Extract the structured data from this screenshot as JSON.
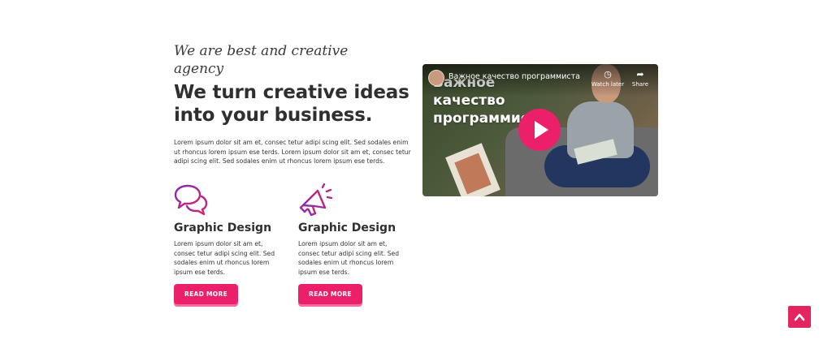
{
  "intro": {
    "tagline": "We are best and creative agency",
    "headline": "We turn creative ideas into your business.",
    "text": "Lorem ipsum dolor sit am et, consec tetur adipi scing elit. Sed sodales enim ut rhoncus lorem ipsum ese terds. Lorem ipsum dolor sit am et, consec tetur adipi scing elit. Sed sodales enim ut rhoncus lorem ipsum ese terds."
  },
  "features": [
    {
      "icon": "speech-bubbles-icon",
      "title": "Graphic Design",
      "text": "Lorem ipsum dolor sit am et, consec tetur adipi scing elit. Sed sodales enim ut rhoncus lorem ipsum ese terds.",
      "button": "READ MORE"
    },
    {
      "icon": "megaphone-icon",
      "title": "Graphic Design",
      "text": "Lorem ipsum dolor sit am et, consec tetur adipi scing elit. Sed sodales enim ut rhoncus lorem ipsum ese terds.",
      "button": "READ MORE"
    }
  ],
  "video": {
    "title": "Важное качество программиста",
    "overlay_text": "Важное качество программиста",
    "watch_later_label": "Watch later",
    "share_label": "Share",
    "watch_later_icon": "clock-icon",
    "share_icon": "share-arrow-icon",
    "play_icon": "play-icon"
  },
  "scroll_top_icon": "chevron-up-icon",
  "colors": {
    "accent": "#ec1f6b",
    "icon_gradient_start": "#7b2cbf",
    "icon_gradient_end": "#e0245e",
    "text_dark": "#2f2f2f"
  }
}
